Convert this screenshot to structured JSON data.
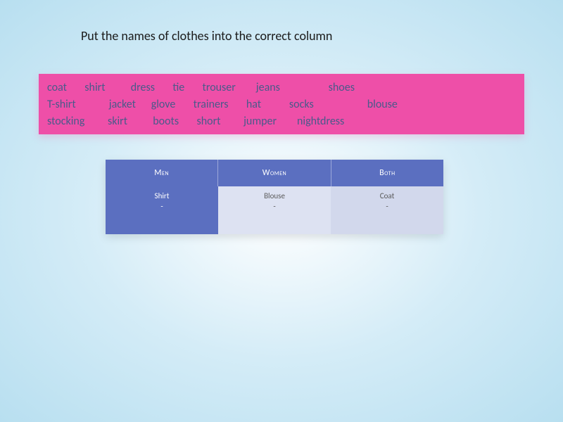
{
  "title": "Put the names of clothes into the correct column",
  "wordbank": {
    "rows": [
      [
        "coat",
        "shirt",
        "dress",
        "tie",
        "trouser",
        "jeans",
        "shoes"
      ],
      [
        "T-shirt",
        "jacket",
        "glove",
        "trainers",
        "hat",
        "socks",
        "blouse"
      ],
      [
        "stocking",
        "skirt",
        "boots",
        "short",
        "jumper",
        "nightdress"
      ]
    ]
  },
  "table": {
    "headers": [
      "Men",
      "Women",
      "Both"
    ],
    "example_row": [
      {
        "item": "Shirt",
        "bullet": "-"
      },
      {
        "item": "Blouse",
        "bullet": "-"
      },
      {
        "item": "Coat",
        "bullet": "-"
      }
    ]
  }
}
